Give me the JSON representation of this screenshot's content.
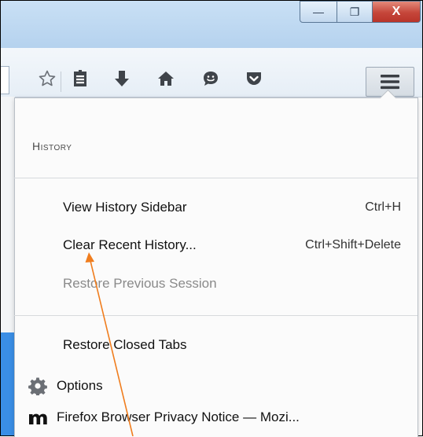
{
  "window": {
    "minimize_label": "—",
    "maximize_label": "❐",
    "close_label": "X"
  },
  "toolbar": {
    "icons": [
      "bookmark-star-icon",
      "reading-list-icon",
      "downloads-icon",
      "home-icon",
      "hello-chat-icon",
      "pocket-icon",
      "hamburger-menu-icon"
    ]
  },
  "history_panel": {
    "heading": "History",
    "items": [
      {
        "label": "View History Sidebar",
        "shortcut": "Ctrl+H",
        "enabled": true
      },
      {
        "label": "Clear Recent History...",
        "shortcut": "Ctrl+Shift+Delete",
        "enabled": true
      },
      {
        "label": "Restore Previous Session",
        "shortcut": "",
        "enabled": false
      }
    ],
    "restore_closed_tabs": "Restore Closed Tabs",
    "recent_tabs": [
      {
        "icon": "gear-icon",
        "label": "Options"
      },
      {
        "icon": "mozilla-m-icon",
        "label": "Firefox Browser Privacy Notice — Mozi..."
      }
    ]
  },
  "annotation": {
    "color": "#f07d1e"
  }
}
